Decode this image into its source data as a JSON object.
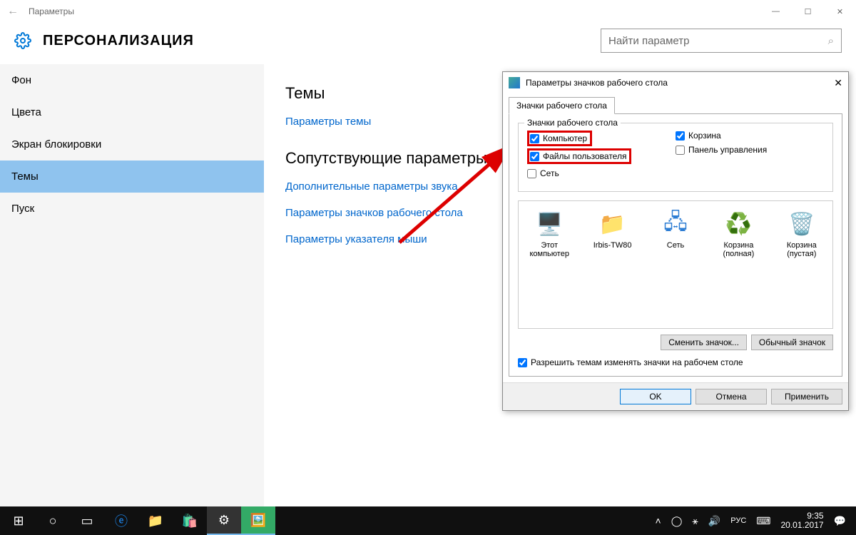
{
  "window": {
    "title": "Параметры"
  },
  "header": {
    "page_title": "ПЕРСОНАЛИЗАЦИЯ",
    "search_placeholder": "Найти параметр"
  },
  "sidebar": {
    "items": [
      {
        "label": "Фон"
      },
      {
        "label": "Цвета"
      },
      {
        "label": "Экран блокировки"
      },
      {
        "label": "Темы"
      },
      {
        "label": "Пуск"
      }
    ]
  },
  "main": {
    "section1": "Темы",
    "link1": "Параметры темы",
    "section2": "Сопутствующие параметры",
    "link2": "Дополнительные параметры звука",
    "link3": "Параметры значков рабочего стола",
    "link4": "Параметры указателя мыши"
  },
  "dialog": {
    "title": "Параметры значков рабочего стола",
    "tab": "Значки рабочего стола",
    "fieldset_legend": "Значки рабочего стола",
    "checks": {
      "computer": "Компьютер",
      "user_files": "Файлы пользователя",
      "network": "Сеть",
      "recycle": "Корзина",
      "control_panel": "Панель управления"
    },
    "icons": [
      {
        "label": "Этот компьютер"
      },
      {
        "label": "Irbis-TW80"
      },
      {
        "label": "Сеть"
      },
      {
        "label": "Корзина (полная)"
      },
      {
        "label": "Корзина (пустая)"
      }
    ],
    "btn_change": "Сменить значок...",
    "btn_default": "Обычный значок",
    "allow_themes": "Разрешить темам изменять значки на рабочем столе",
    "btn_ok": "OK",
    "btn_cancel": "Отмена",
    "btn_apply": "Применить"
  },
  "taskbar": {
    "time": "9:35",
    "date": "20.01.2017"
  }
}
